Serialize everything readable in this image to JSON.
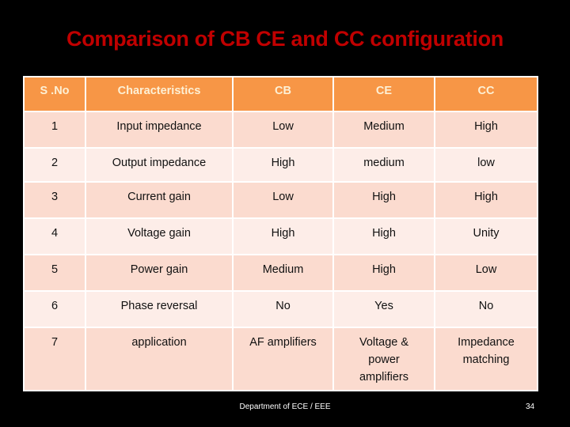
{
  "slide": {
    "title": "Comparison of CB CE and CC configuration",
    "footer": "Department of ECE / EEE",
    "page_number": "34"
  },
  "colors": {
    "title": "#c00000",
    "header_fill": "#f79646",
    "header_text": "#fdf0d5",
    "row_odd_fill": "#fbdbcf",
    "row_even_fill": "#fdede8",
    "background": "#000000"
  },
  "table": {
    "headers": [
      "S .No",
      "Characteristics",
      "CB",
      "CE",
      "CC"
    ],
    "rows": [
      [
        "1",
        "Input impedance",
        "Low",
        "Medium",
        "High"
      ],
      [
        "2",
        "Output impedance",
        "High",
        "medium",
        "low"
      ],
      [
        "3",
        "Current gain",
        "Low",
        "High",
        "High"
      ],
      [
        "4",
        "Voltage gain",
        "High",
        "High",
        "Unity"
      ],
      [
        "5",
        "Power gain",
        "Medium",
        "High",
        "Low"
      ],
      [
        "6",
        "Phase reversal",
        "No",
        "Yes",
        "No"
      ],
      [
        "7",
        "application",
        "AF amplifiers",
        "Voltage & power amplifiers",
        "Impedance matching"
      ]
    ]
  }
}
